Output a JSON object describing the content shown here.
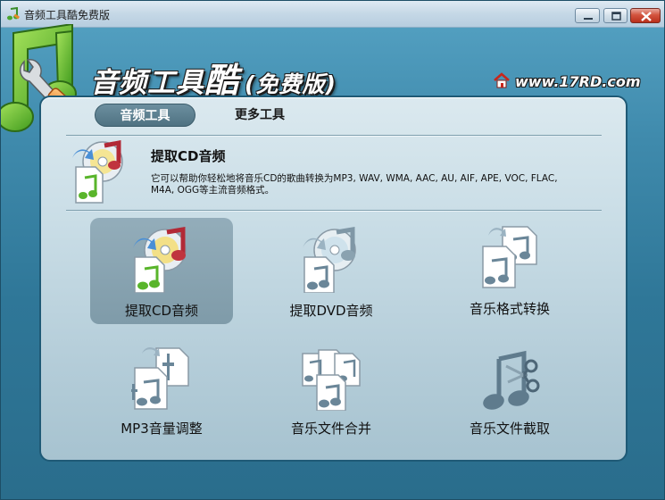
{
  "window": {
    "title": "音频工具酷免费版"
  },
  "header": {
    "app_title_main": "音频工具",
    "app_title_big": "酷",
    "app_title_sub": "(免费版)",
    "site_url": "www.17RD.com"
  },
  "tabs": [
    {
      "label": "音频工具",
      "active": true
    },
    {
      "label": "更多工具",
      "active": false
    }
  ],
  "feature": {
    "title": "提取CD音频",
    "description": "它可以帮助你轻松地将音乐CD的歌曲转换为MP3, WAV, WMA, AAC, AU, AIF, APE, VOC, FLAC, M4A, OGG等主流音频格式。"
  },
  "tools": [
    {
      "label": "提取CD音频",
      "selected": true
    },
    {
      "label": "提取DVD音频",
      "selected": false
    },
    {
      "label": "音乐格式转换",
      "selected": false
    },
    {
      "label": "MP3音量调整",
      "selected": false
    },
    {
      "label": "音乐文件合并",
      "selected": false
    },
    {
      "label": "音乐文件截取",
      "selected": false
    }
  ],
  "colors": {
    "note_green": "#5fbf2a",
    "note_red": "#c0343e",
    "frame_blue": "#3f8aac",
    "panel_light": "#c9dde6"
  },
  "icons": {
    "logo": "music-note-wrench-icon",
    "home": "home-icon",
    "cd_extract": "cd-music-icon",
    "dvd_extract": "dvd-music-icon",
    "format_convert": "file-convert-icon",
    "volume": "volume-file-icon",
    "merge": "file-merge-icon",
    "cut": "scissors-note-icon"
  }
}
